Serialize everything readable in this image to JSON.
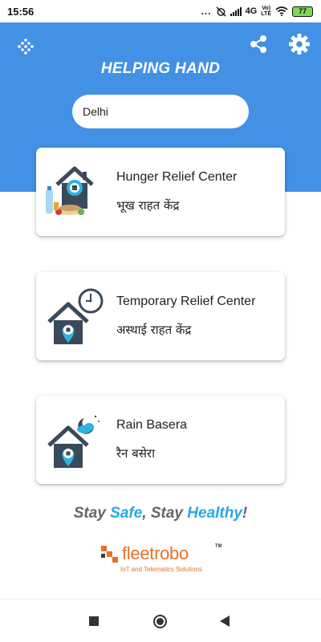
{
  "status_bar": {
    "time": "15:56",
    "dots": "...",
    "network": "4G",
    "volte_top": "Vo)",
    "volte_bottom": "LTE",
    "battery": "77"
  },
  "header": {
    "title": "HELPING HAND",
    "location": "Delhi",
    "background_color": "#4291e5"
  },
  "cards": [
    {
      "title": "Hunger Relief Center",
      "subtitle": "भूख राहत केंद्र",
      "icon": "home-food-icon"
    },
    {
      "title": "Temporary Relief Center",
      "subtitle": "अस्थाई राहत केंद्र",
      "icon": "home-clock-icon"
    },
    {
      "title": "Rain Basera",
      "subtitle": "रैन बसेरा",
      "icon": "home-night-icon"
    }
  ],
  "tagline": {
    "part1": "Stay ",
    "part2": "Safe",
    "part3": ", Stay ",
    "part4": "Healthy",
    "part5": "!"
  },
  "footer": {
    "logo_text": "fleetrobo",
    "logo_tm": "TM",
    "logo_tagline": "IoT and Telematics Solutions",
    "brand_color": "#e86f2a"
  },
  "colors": {
    "accent": "#29a8e0",
    "tagline_gray": "#666666"
  }
}
